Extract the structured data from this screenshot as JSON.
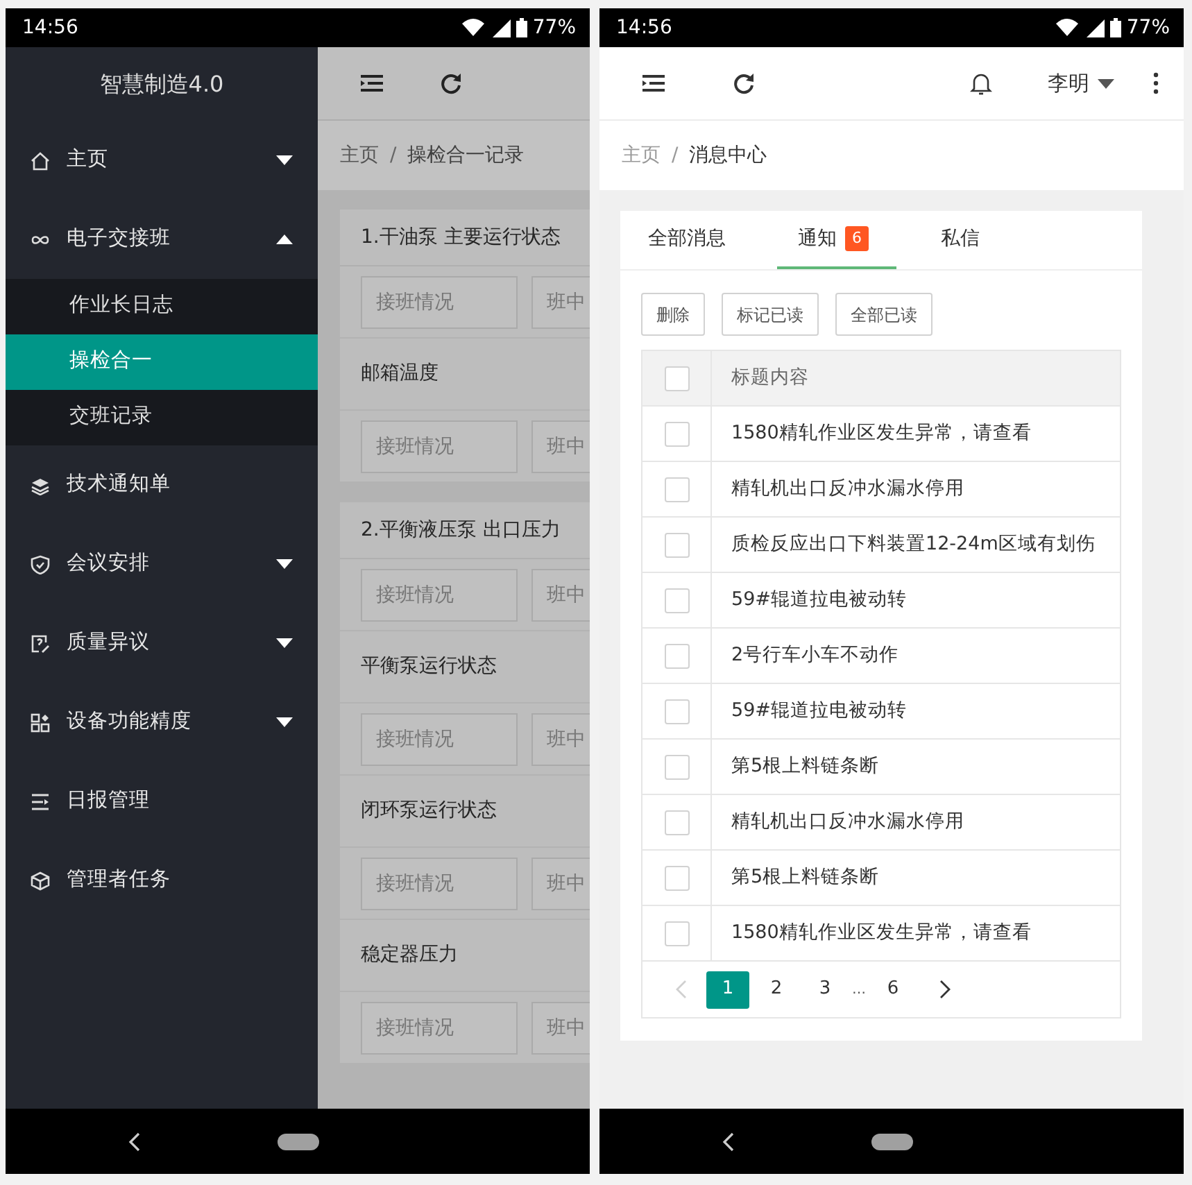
{
  "left_screen": {
    "status_bar": {
      "time": "14:56",
      "battery": "77%"
    },
    "sidebar": {
      "title": "智慧制造4.0",
      "items": [
        {
          "label": "主页",
          "expanded": false
        },
        {
          "label": "电子交接班",
          "expanded": true,
          "children": [
            {
              "label": "作业长日志",
              "selected": false
            },
            {
              "label": "操检合一",
              "selected": true
            },
            {
              "label": "交班记录",
              "selected": false
            }
          ]
        },
        {
          "label": "技术通知单"
        },
        {
          "label": "会议安排",
          "expanded": false
        },
        {
          "label": "质量异议",
          "expanded": false
        },
        {
          "label": "设备功能精度",
          "expanded": false
        },
        {
          "label": "日报管理"
        },
        {
          "label": "管理者任务"
        }
      ]
    },
    "breadcrumb": {
      "separator": "/",
      "items": [
        "主页",
        "操检合一记录"
      ]
    },
    "cards": [
      {
        "title": "1.干油泵 主要运行状态",
        "rows": [
          {
            "kind": "fields",
            "placeholders": [
              "接班情况",
              "班中"
            ]
          },
          {
            "kind": "label",
            "text": "邮箱温度"
          },
          {
            "kind": "fields",
            "placeholders": [
              "接班情况",
              "班中"
            ]
          }
        ]
      },
      {
        "title": "2.平衡液压泵 出口压力",
        "rows": [
          {
            "kind": "fields",
            "placeholders": [
              "接班情况",
              "班中"
            ]
          },
          {
            "kind": "label",
            "text": "平衡泵运行状态"
          },
          {
            "kind": "fields",
            "placeholders": [
              "接班情况",
              "班中"
            ]
          },
          {
            "kind": "label",
            "text": "闭环泵运行状态"
          },
          {
            "kind": "fields",
            "placeholders": [
              "接班情况",
              "班中"
            ]
          },
          {
            "kind": "label",
            "text": "稳定器压力"
          },
          {
            "kind": "fields",
            "placeholders": [
              "接班情况",
              "班中"
            ]
          }
        ]
      }
    ]
  },
  "right_screen": {
    "status_bar": {
      "time": "14:56",
      "battery": "77%"
    },
    "user": "李明",
    "breadcrumb": {
      "separator": "/",
      "items": [
        "主页",
        "消息中心"
      ]
    },
    "tabs": [
      {
        "label": "全部消息",
        "selected": false
      },
      {
        "label": "通知",
        "selected": true,
        "badge": "6"
      },
      {
        "label": "私信",
        "selected": false
      }
    ],
    "buttons": [
      "删除",
      "标记已读",
      "全部已读"
    ],
    "table": {
      "header": {
        "label": "标题内容",
        "checked": false
      },
      "rows": [
        {
          "title": "1580精轧作业区发生异常，请查看",
          "checked": false
        },
        {
          "title": "精轧机出口反冲水漏水停用",
          "checked": false
        },
        {
          "title": "质检反应出口下料装置12-24m区域有划伤",
          "checked": false
        },
        {
          "title": "59#辊道拉电被动转",
          "checked": false
        },
        {
          "title": "2号行车小车不动作",
          "checked": false
        },
        {
          "title": "59#辊道拉电被动转",
          "checked": false
        },
        {
          "title": "第5根上料链条断",
          "checked": false
        },
        {
          "title": "精轧机出口反冲水漏水停用",
          "checked": false
        },
        {
          "title": "第5根上料链条断",
          "checked": false
        },
        {
          "title": "1580精轧作业区发生异常，请查看",
          "checked": false
        }
      ]
    },
    "pagination": {
      "prev_disabled": true,
      "pages": [
        {
          "label": "1",
          "selected": true
        },
        {
          "label": "2",
          "selected": false
        },
        {
          "label": "3",
          "selected": false
        },
        {
          "label": "…",
          "kind": "ellipsis"
        },
        {
          "label": "6",
          "selected": false
        }
      ]
    }
  }
}
